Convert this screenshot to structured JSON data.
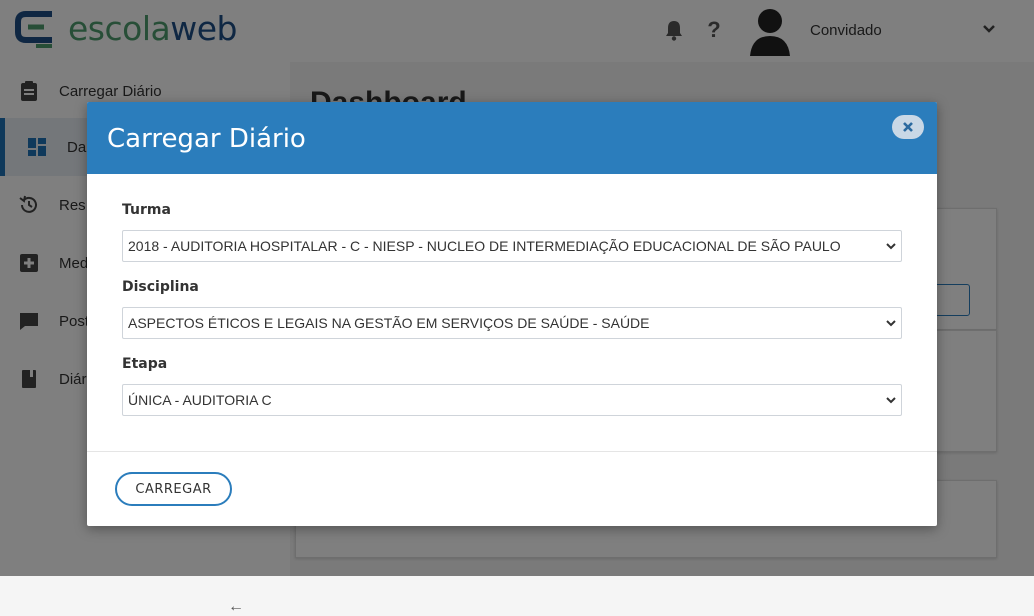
{
  "brand": {
    "name_part1": "escola",
    "name_part2": "web",
    "color_green": "#4e9d6e",
    "color_blue": "#1e4f86"
  },
  "header": {
    "username": "Convidado",
    "help_icon": "question-icon",
    "bell_icon": "bell-icon"
  },
  "sidebar": {
    "items": [
      {
        "label": "Carregar Diário",
        "icon": "clipboard-icon"
      },
      {
        "label": "Da",
        "icon": "dashboard-icon"
      },
      {
        "label": "Res",
        "icon": "history-icon"
      },
      {
        "label": "Med",
        "icon": "plus-square-icon"
      },
      {
        "label": "Post",
        "icon": "chat-icon"
      },
      {
        "label": "Diár",
        "icon": "book-icon"
      }
    ],
    "collapse_glyph": "←"
  },
  "main": {
    "title": "Dashboard"
  },
  "modal": {
    "title": "Carregar Diário",
    "header_color": "#2b7dbc",
    "fields": [
      {
        "label": "Turma",
        "value": "2018 - AUDITORIA HOSPITALAR - C - NIESP - NUCLEO DE INTERMEDIAÇÃO EDUCACIONAL DE SÃO PAULO"
      },
      {
        "label": "Disciplina",
        "value": "ASPECTOS ÉTICOS E LEGAIS NA GESTÃO EM SERVIÇOS DE SAÚDE - SAÚDE"
      },
      {
        "label": "Etapa",
        "value": "ÚNICA - AUDITORIA C"
      }
    ],
    "submit_label": "CARREGAR"
  }
}
